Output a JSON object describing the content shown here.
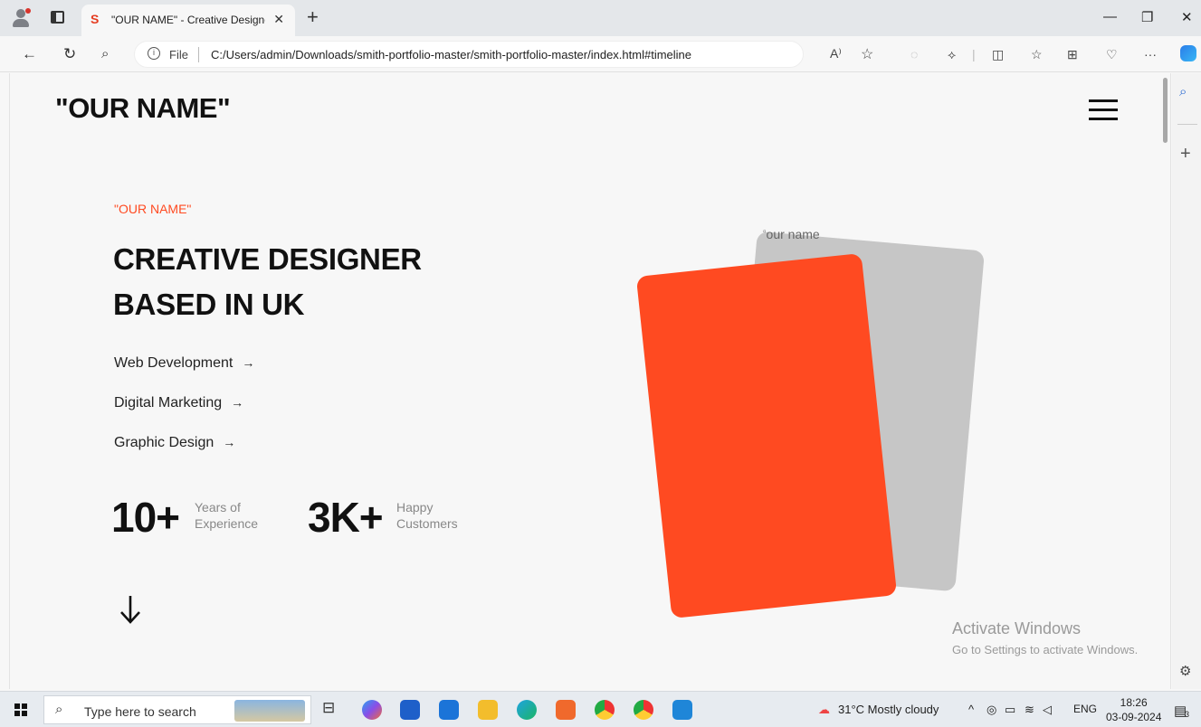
{
  "browser": {
    "tab_favicon": "S",
    "tab_title": "\"OUR NAME\" - Creative Designer",
    "tab_close": "✕",
    "new_tab": "+",
    "url_scheme": "File",
    "url_path": "C:/Users/admin/Downloads/smith-portfolio-master/smith-portfolio-master/index.html#timeline",
    "read_aloud": "A⁾",
    "more": "···"
  },
  "page": {
    "logo": "\"OUR NAME\"",
    "eyebrow": "\"OUR NAME\"",
    "headline_line1": "CREATIVE DESIGNER",
    "headline_line2": "BASED IN UK",
    "services": [
      {
        "label": "Web Development"
      },
      {
        "label": "Digital Marketing"
      },
      {
        "label": "Graphic Design"
      }
    ],
    "service_arrow": "→",
    "stats": [
      {
        "number": "10+",
        "label_line1": "Years of",
        "label_line2": "Experience"
      },
      {
        "number": "3K+",
        "label_line1": "Happy",
        "label_line2": "Customers"
      }
    ],
    "image_alt": "our name",
    "accent_color": "#ff4a21",
    "card_grey_color": "#c6c6c6"
  },
  "watermark": {
    "title": "Activate Windows",
    "subtitle": "Go to Settings to activate Windows."
  },
  "taskbar": {
    "search_placeholder": "Type here to search",
    "weather": "31°C  Mostly cloudy",
    "language": "ENG",
    "time": "18:26",
    "date": "03-09-2024",
    "notification_count": "3"
  }
}
